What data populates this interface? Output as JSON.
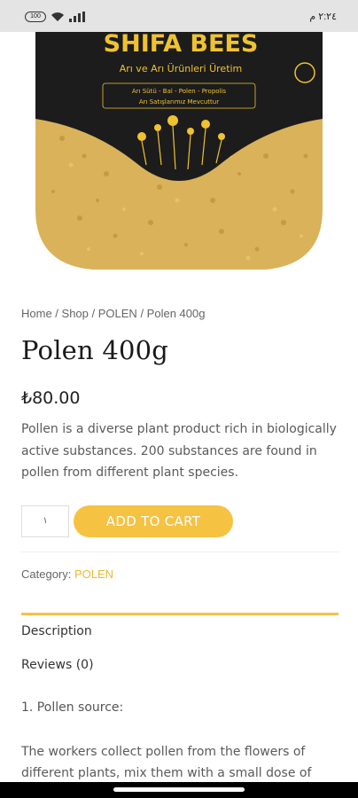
{
  "status_bar": {
    "battery": "100",
    "time": "٢:٢٤ م"
  },
  "product_image": {
    "brand": "SHIFA BEES",
    "tagline": "Arı ve Arı Ürünleri Üretim",
    "products_line": "Arı Sütü - Bal - Polen - Propolis",
    "sales_line": "Arı Satışlarımız Mevcuttur",
    "colors": {
      "label": "#1c1c1c",
      "gold": "#f0c230",
      "pollen": "#c9a24a"
    }
  },
  "breadcrumb": {
    "home": "Home",
    "shop": "Shop",
    "category": "POLEN",
    "current": "Polen 400g",
    "separator": " / "
  },
  "product": {
    "title": "Polen 400g",
    "price": "₺80.00",
    "short_description": "Pollen is a diverse plant product rich in biologically active substances. 200 substances are found in pollen from different plant species."
  },
  "cart": {
    "quantity": "١",
    "add_to_cart_label": "ADD TO CART",
    "accent": "#f5c242"
  },
  "meta": {
    "category_label": "Category:",
    "category_value": "POLEN"
  },
  "tabs": {
    "description": "Description",
    "reviews": "Reviews (0)"
  },
  "description": {
    "heading": "1. Pollen source:",
    "body": "The workers collect pollen from the flowers of different plants, mix them with a small dose of"
  }
}
